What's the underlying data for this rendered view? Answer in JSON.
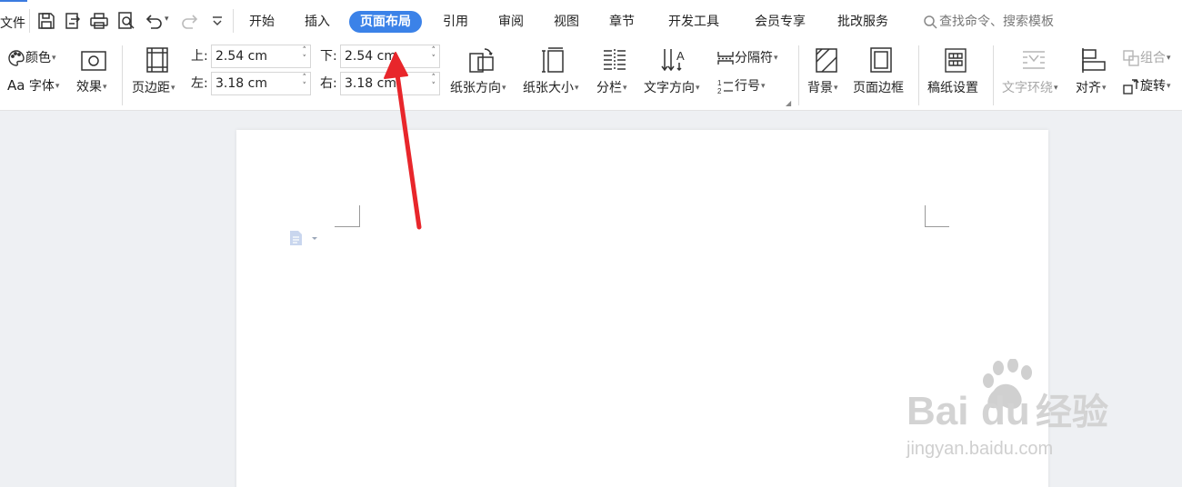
{
  "menubar": {
    "file_label": "文件",
    "tabs": [
      "开始",
      "插入",
      "页面布局",
      "引用",
      "审阅",
      "视图",
      "章节",
      "开发工具",
      "会员专享",
      "批改服务"
    ],
    "active_tab": "页面布局",
    "search_placeholder": "查找命令、搜索模板",
    "accent_color": "#3b82e8"
  },
  "ribbon": {
    "color_label": "颜色",
    "font_label": "字体",
    "effects_label": "效果",
    "margins_label": "页边距",
    "margin_top_label": "上:",
    "margin_top_value": "2.54 cm",
    "margin_bottom_label": "下:",
    "margin_bottom_value": "2.54 cm",
    "margin_left_label": "左:",
    "margin_left_value": "3.18 cm",
    "margin_right_label": "右:",
    "margin_right_value": "3.18 cm",
    "orientation_label": "纸张方向",
    "size_label": "纸张大小",
    "columns_label": "分栏",
    "text_direction_label": "文字方向",
    "breaks_label": "分隔符",
    "line_numbers_label": "行号",
    "background_label": "背景",
    "page_border_label": "页面边框",
    "manuscript_label": "稿纸设置",
    "text_wrap_label": "文字环绕",
    "align_label": "对齐",
    "group_label": "组合",
    "rotate_label": "旋转"
  },
  "watermark": {
    "brand_text": "Bai du 经验",
    "url_text": "jingyan.baidu.com"
  },
  "annotation": {
    "arrow_color": "#e8262b"
  }
}
